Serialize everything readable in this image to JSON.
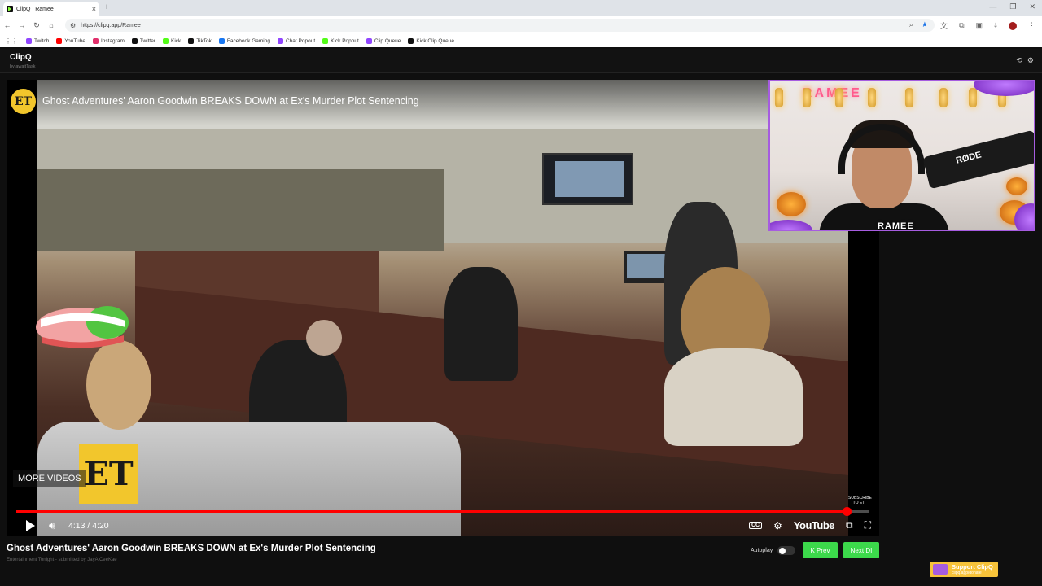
{
  "browser": {
    "tab_title": "ClipQ | Ramee",
    "tab_close": "×",
    "new_tab": "+",
    "url": "https://clipq.app/Ramee",
    "bookmarks": [
      {
        "label": "Twitch",
        "color": "#9146ff"
      },
      {
        "label": "YouTube",
        "color": "#ff0000"
      },
      {
        "label": "Instagram",
        "color": "#e1306c"
      },
      {
        "label": "Twitter",
        "color": "#111111"
      },
      {
        "label": "Kick",
        "color": "#53fc18"
      },
      {
        "label": "TikTok",
        "color": "#111111"
      },
      {
        "label": "Facebook Gaming",
        "color": "#1877f2"
      },
      {
        "label": "Chat Popout",
        "color": "#9146ff"
      },
      {
        "label": "Kick Popout",
        "color": "#53fc18"
      },
      {
        "label": "Clip Queue",
        "color": "#9146ff"
      },
      {
        "label": "Kick Clip Queue",
        "color": "#111111"
      }
    ]
  },
  "app": {
    "name": "ClipQ",
    "byline": "by awaitTask"
  },
  "player": {
    "channel_badge": "ET",
    "video_title": "Ghost Adventures' Aaron Goodwin BREAKS DOWN at Ex's Murder Plot Sentencing",
    "more_videos": "MORE VIDEOS",
    "et_logo": "ET",
    "subscribe": "SUBSCRIBE TO ET",
    "time": "4:13 / 4:20",
    "progress_fraction": 0.973,
    "youtube_label": "YouTube",
    "cc_label": "CC",
    "accent": "#ff0000"
  },
  "webcam": {
    "neon_sign": "RAMEE",
    "mic_brand": "RØDE",
    "streamer_name": "RAMEE"
  },
  "now_playing": {
    "title": "Ghost Adventures' Aaron Goodwin BREAKS DOWN at Ex's Murder Plot Sentencing",
    "meta": "Entertainment Tonight - submitted by JayAiCeeKae",
    "autoplay_label": "Autoplay",
    "autoplay_on": false,
    "prev_label": "K Prev",
    "next_label": "Next DI",
    "button_color": "#3cd94b"
  },
  "support": {
    "title": "Support ClipQ",
    "url": "clipq.app/donate"
  }
}
